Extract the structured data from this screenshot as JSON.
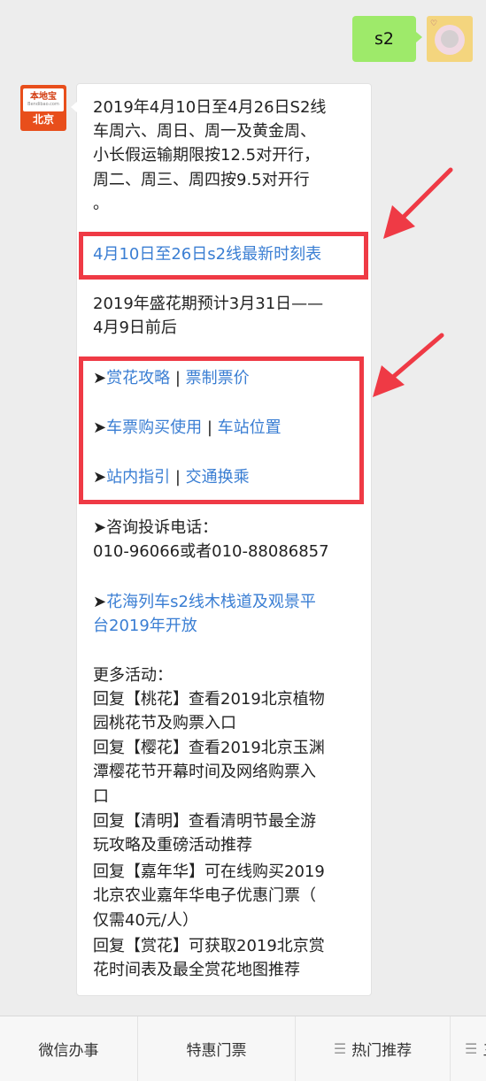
{
  "user_message": {
    "text": "s2"
  },
  "bot": {
    "avatar_name": "本地宝",
    "avatar_domain": "Bendibao.com",
    "avatar_city": "北京"
  },
  "message": {
    "intro": [
      "2019年4月10日至4月26日S2线",
      "车周六、周日、周一及黄金周、",
      "小长假运输期限按12.5对开行，",
      "周二、周三、周四按9.5对开行",
      "。"
    ],
    "timetable_link": "4月10日至26日s2线最新时刻表",
    "bloom": [
      "2019年盛花期预计3月31日——",
      "4月9日前后"
    ],
    "bullet": "➤",
    "separator": "|",
    "nav_links": [
      [
        "赏花攻略",
        "票制票价"
      ],
      [
        "车票购买使用",
        "车站位置"
      ],
      [
        "站内指引",
        "交通换乘"
      ]
    ],
    "contact_label": "咨询投诉电话：",
    "contact_phones": "010-96066或者010-88086857",
    "news_link": [
      "花海列车s2线木栈道及观景平",
      "台2019年开放"
    ],
    "more_title": "更多活动：",
    "more_lines": [
      "回复【桃花】查看2019北京植物",
      "园桃花节及购票入口",
      "回复【樱花】查看2019北京玉渊",
      "潭樱花节开幕时间及网络购票入",
      "口",
      "回复【清明】查看清明节最全游",
      "玩攻略及重磅活动推荐",
      "回复【嘉年华】可在线购买2019",
      "北京农业嘉年华电子优惠门票（",
      "仅需40元/人）",
      "回复【赏花】可获取2019北京赏",
      "花时间表及最全赏花地图推荐"
    ]
  },
  "bottom_menu": {
    "tabs": [
      "微信办事",
      "特惠门票",
      "热门推荐"
    ],
    "partial_tab": "三"
  },
  "colors": {
    "link": "#3a7ed3",
    "highlight": "#ef3a45",
    "user_bubble": "#9eea6a",
    "brand": "#e84e1b"
  }
}
